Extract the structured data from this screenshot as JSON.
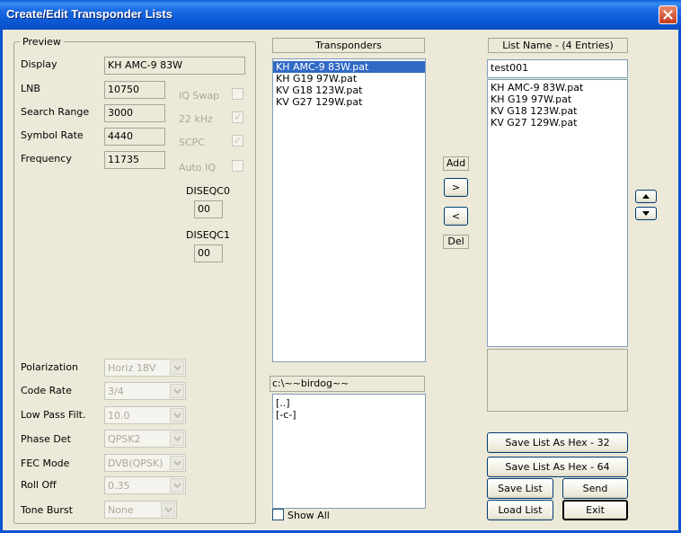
{
  "window": {
    "title": "Create/Edit Transponder Lists"
  },
  "preview": {
    "legend": "Preview",
    "display_label": "Display",
    "display_value": "KH AMC-9 83W",
    "lnb_label": "LNB",
    "lnb_value": "10750",
    "search_range_label": "Search Range",
    "search_range_value": "3000",
    "symbol_rate_label": "Symbol Rate",
    "symbol_rate_value": "4440",
    "frequency_label": "Frequency",
    "frequency_value": "11735",
    "iq_swap_label": "IQ Swap",
    "iq_swap_checked": false,
    "khz22_label": "22 kHz",
    "khz22_checked": true,
    "scpc_label": "SCPC",
    "scpc_checked": true,
    "auto_iq_label": "Auto IQ",
    "auto_iq_checked": false,
    "diseqc0_label": "DISEQC0",
    "diseqc0_value": "00",
    "diseqc1_label": "DISEQC1",
    "diseqc1_value": "00",
    "polarization_label": "Polarization",
    "polarization_value": "Horiz 18V",
    "code_rate_label": "Code Rate",
    "code_rate_value": "3/4",
    "low_pass_label": "Low Pass Filt.",
    "low_pass_value": "10.0",
    "phase_det_label": "Phase Det",
    "phase_det_value": "QPSK2",
    "fec_mode_label": "FEC Mode",
    "fec_mode_value": "DVB(QPSK)",
    "roll_off_label": "Roll Off",
    "roll_off_value": "0.35",
    "tone_burst_label": "Tone Burst",
    "tone_burst_value": "None"
  },
  "transponders": {
    "header": "Transponders",
    "items": [
      {
        "label": "KH AMC-9 83W.pat",
        "selected": true
      },
      {
        "label": "KH G19 97W.pat",
        "selected": false
      },
      {
        "label": "KV G18 123W.pat",
        "selected": false
      },
      {
        "label": "KV G27 129W.pat",
        "selected": false
      }
    ]
  },
  "directory": {
    "path": "c:\\~~birdog~~",
    "items": [
      "[..]",
      "[-c-]"
    ],
    "show_all_label": "Show All",
    "show_all_checked": false
  },
  "middle": {
    "add_label": "Add",
    "add_button": ">",
    "del_button": "<",
    "del_label": "Del"
  },
  "list": {
    "header": "List Name - (4 Entries)",
    "name_value": "test001",
    "items": [
      "KH AMC-9 83W.pat",
      "KH G19 97W.pat",
      "KV G18 123W.pat",
      "KV G27 129W.pat"
    ]
  },
  "buttons": {
    "save_hex32": "Save List As Hex - 32",
    "save_hex64": "Save List As Hex - 64",
    "save_list": "Save List",
    "send": "Send",
    "load_list": "Load List",
    "exit": "Exit"
  },
  "icons": {
    "close": "close-icon",
    "dropdown": "chevron-down-icon",
    "move_up": "arrow-up-icon",
    "move_down": "arrow-down-icon"
  },
  "colors": {
    "title_bar": "#0a5fd6",
    "selection": "#316ac5",
    "close_button": "#c6391c"
  }
}
